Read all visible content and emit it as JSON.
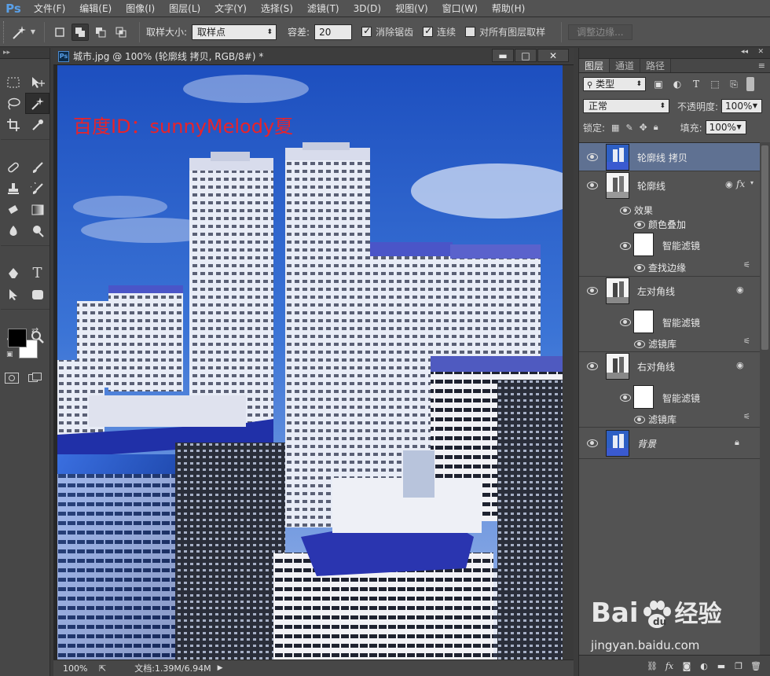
{
  "app": {
    "logo": "Ps"
  },
  "menu": [
    "文件(F)",
    "编辑(E)",
    "图像(I)",
    "图层(L)",
    "文字(Y)",
    "选择(S)",
    "滤镜(T)",
    "3D(D)",
    "视图(V)",
    "窗口(W)",
    "帮助(H)"
  ],
  "options": {
    "sample_size_label": "取样大小:",
    "sample_size_value": "取样点",
    "tolerance_label": "容差:",
    "tolerance_value": "20",
    "anti_alias_label": "消除锯齿",
    "anti_alias_checked": true,
    "contiguous_label": "连续",
    "contiguous_checked": true,
    "all_layers_label": "对所有图层取样",
    "all_layers_checked": false,
    "refine_edge_label": "调整边缘..."
  },
  "colors": {
    "foreground": "#000000",
    "background": "#ffffff",
    "accent": "#5aa0e8",
    "watermark_red": "#e8232a"
  },
  "document": {
    "title": "城市.jpg @ 100% (轮廓线 拷贝, RGB/8#) *",
    "ps_icon": "Ps",
    "canvas_text": "百度ID：sunnyMelody夏",
    "zoom": "100%",
    "doc_info": "文档:1.39M/6.94M",
    "buttons": {
      "minimize": "▬",
      "maximize": "□",
      "close": "✕"
    }
  },
  "panel": {
    "tabs": [
      "图层",
      "通道",
      "路径"
    ],
    "filter_kind": "类型",
    "blend_mode": "正常",
    "opacity_label": "不透明度:",
    "opacity_value": "100%",
    "lock_label": "锁定:",
    "fill_label": "填充:",
    "fill_value": "100%",
    "layers": [
      {
        "name": "轮廓线 拷贝",
        "selected": true
      },
      {
        "name": "轮廓线",
        "fx": "fx",
        "effects_label": "效果",
        "effect": "颜色叠加",
        "smart_filter": "智能滤镜",
        "filter_item": "查找边缘"
      },
      {
        "name": "左对角线",
        "smart_filter": "智能滤镜",
        "filter_item": "滤镜库"
      },
      {
        "name": "右对角线",
        "smart_filter": "智能滤镜",
        "filter_item": "滤镜库"
      },
      {
        "name": "背景",
        "locked": true
      }
    ]
  },
  "watermark": {
    "brand": "Bai",
    "brand_suffix": "经验",
    "url": "jingyan.baidu.com"
  }
}
